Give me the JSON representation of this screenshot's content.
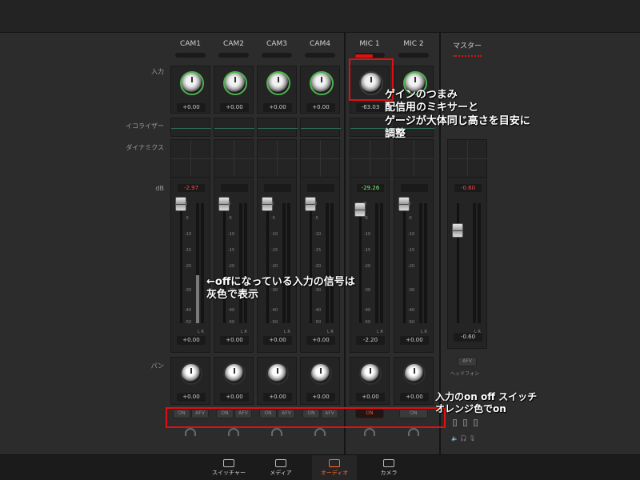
{
  "row_labels": {
    "input": "入力",
    "eq": "イコライザー",
    "dynamics": "ダイナミクス",
    "db": "dB",
    "pan": "パン"
  },
  "channels": [
    {
      "name": "CAM1",
      "gain": "+0.00",
      "peak": "-2.97",
      "peak_color": "#ff4040",
      "fader": "+0.00",
      "pan": "+0.00",
      "on": "ON",
      "afv": "AFV"
    },
    {
      "name": "CAM2",
      "gain": "+0.00",
      "peak": "",
      "peak_color": "#ff4040",
      "fader": "+0.00",
      "pan": "+0.00",
      "on": "ON",
      "afv": "AFV"
    },
    {
      "name": "CAM3",
      "gain": "+0.00",
      "peak": "",
      "peak_color": "#ff4040",
      "fader": "+0.00",
      "pan": "+0.00",
      "on": "ON",
      "afv": "AFV"
    },
    {
      "name": "CAM4",
      "gain": "+0.00",
      "peak": "",
      "peak_color": "#ff4040",
      "fader": "+0.00",
      "pan": "+0.00",
      "on": "ON",
      "afv": "AFV"
    },
    {
      "name": "MIC 1",
      "gain": "-63.03",
      "peak": "-29.26",
      "peak_color": "#6cff6c",
      "fader": "-2.20",
      "pan": "+0.00",
      "on": "ON",
      "afv": ""
    },
    {
      "name": "MIC 2",
      "gain": "",
      "peak": "",
      "peak_color": "#ff4040",
      "fader": "+0.00",
      "pan": "+0.00",
      "on": "ON",
      "afv": ""
    }
  ],
  "fader_scale": [
    "0",
    "-5",
    "-10",
    "-15",
    "-20",
    "-30",
    "-40",
    "-50"
  ],
  "meter_lr": "L R",
  "master": {
    "name": "マスター",
    "peak": "-0.60",
    "fader": "-0.60",
    "afv": "AFV",
    "headphones": "ヘッドフォン"
  },
  "tabs": [
    {
      "label": "スイッチャー",
      "active": false
    },
    {
      "label": "メディア",
      "active": false
    },
    {
      "label": "オーディオ",
      "active": true
    },
    {
      "label": "カメラ",
      "active": false
    }
  ],
  "annotations": {
    "gain_note": "ゲインのつまみ\n配信用のミキサーと\nゲージが大体同じ高さを目安に\n調整",
    "off_note": "←offになっている入力の信号は\n灰色で表示",
    "switch_note": "入力のon off スイッチ\nオレンジ色でon"
  },
  "colors": {
    "annotation_red": "#e01010",
    "active_orange": "#ff6a30",
    "eq_green": "#2f6f58"
  }
}
